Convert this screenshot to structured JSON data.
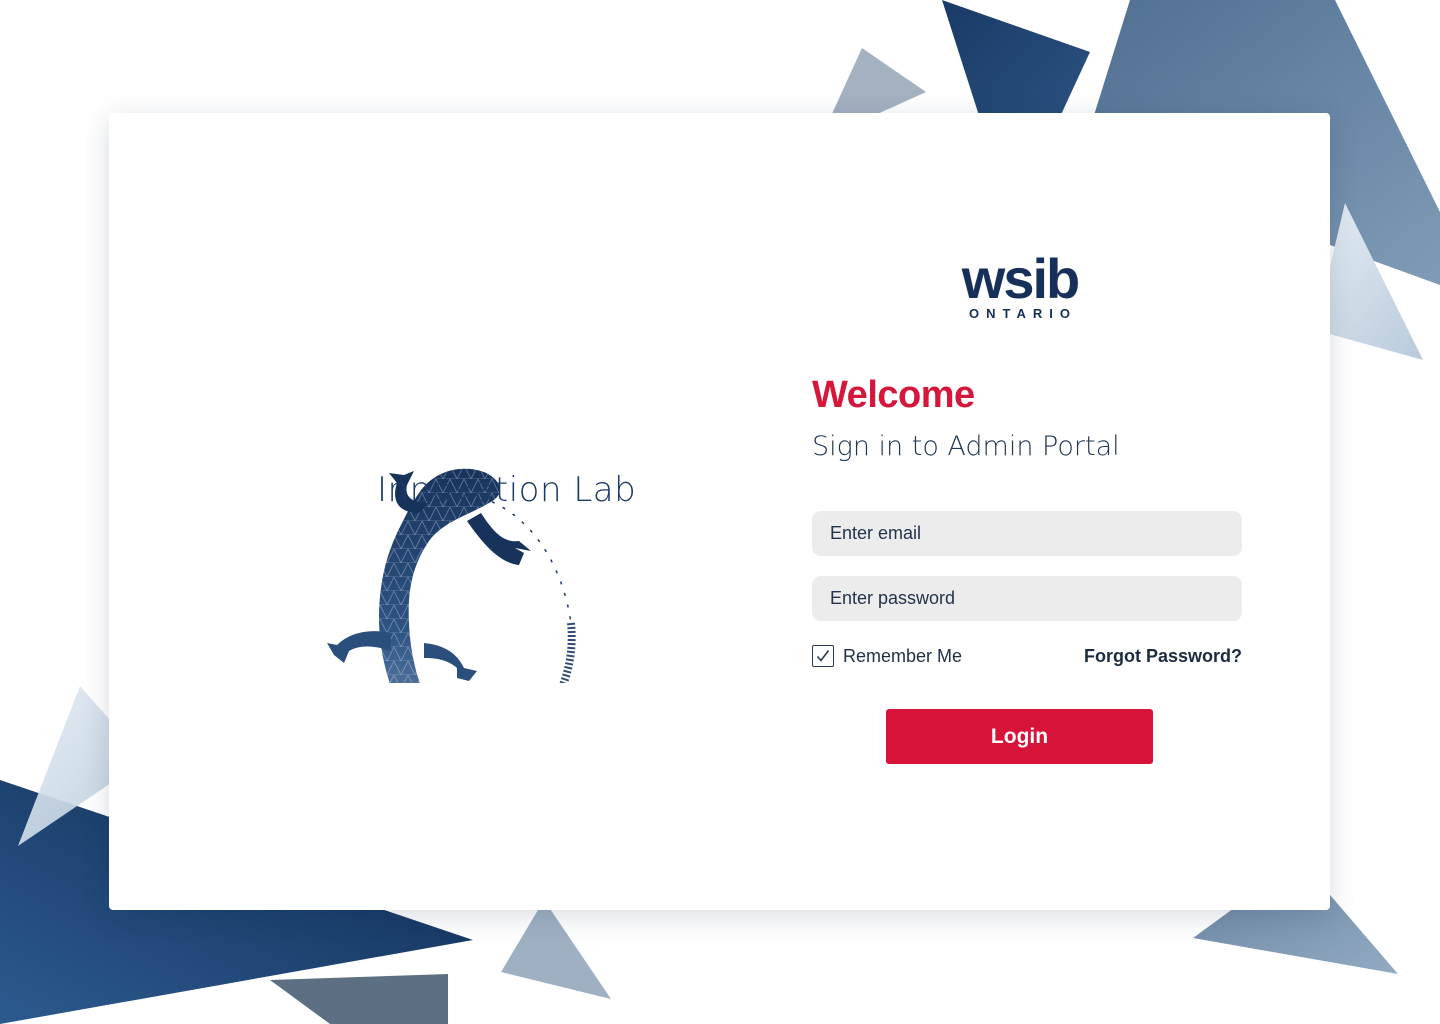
{
  "brand": {
    "name": "Innovation Lab",
    "mascot_icon": "salamander-icon"
  },
  "logo": {
    "main": "wsib",
    "sub": "ONTARIO"
  },
  "header": {
    "welcome": "Welcome",
    "subtitle": "Sign in to Admin Portal"
  },
  "form": {
    "email_placeholder": "Enter email",
    "email_value": "",
    "password_placeholder": "Enter password",
    "password_value": "",
    "remember_label": "Remember Me",
    "remember_checked": true,
    "checkbox_icon": "checkmark-icon",
    "forgot_label": "Forgot Password?",
    "login_label": "Login"
  },
  "colors": {
    "accent_red": "#d7133a",
    "navy": "#17305a",
    "input_bg": "#ececed"
  }
}
